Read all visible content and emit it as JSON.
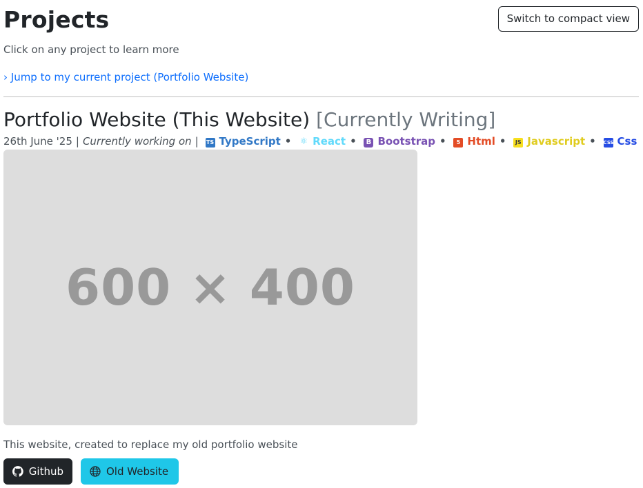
{
  "header": {
    "title": "Projects",
    "toggle_label": "Switch to compact view"
  },
  "subtitle": "Click on any project to learn more",
  "jump_link": "› Jump to my current project (Portfolio Website)",
  "project": {
    "title": "Portfolio Website (This Website)",
    "status": "[Currently Writing]",
    "date": "26th June '25",
    "state": "Currently working on",
    "tech": [
      {
        "label": "TypeScript",
        "icon": "typescript-icon",
        "color": "#3178c6"
      },
      {
        "label": "React",
        "icon": "react-icon",
        "color": "#61dafb"
      },
      {
        "label": "Bootstrap",
        "icon": "bootstrap-icon",
        "color": "#7952b3"
      },
      {
        "label": "Html",
        "icon": "html5-icon",
        "color": "#e34c26"
      },
      {
        "label": "Javascript",
        "icon": "javascript-icon",
        "color": "#f7df1e"
      },
      {
        "label": "Css",
        "icon": "css3-icon",
        "color": "#264de4"
      }
    ],
    "image_placeholder": "600 × 400",
    "description": "This website, created to replace my old portfolio website",
    "buttons": {
      "github": "Github",
      "old_website": "Old Website"
    }
  },
  "colors": {
    "link": "#0d6efd",
    "github_button": "#212529",
    "old_website_button": "#1fc7e8"
  }
}
